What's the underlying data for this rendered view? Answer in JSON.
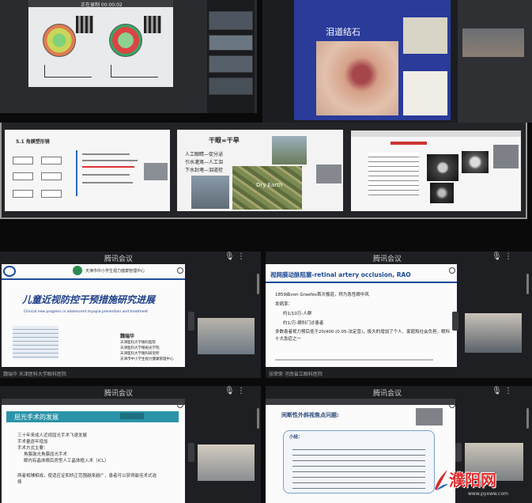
{
  "meeting_app_title": "腾讯会议",
  "tiles": {
    "t1": {
      "toolbar_text": "正在录制 00:00:02"
    },
    "t2": {
      "slide_title": "泪道结石"
    },
    "t3": {
      "heading": "5.1 角膜塑形镜"
    },
    "t4": {
      "title": "干眼=干旱",
      "lines": [
        "人工眼睛—促分泌",
        "引水灌溉—人工泪",
        "下水封堵—泪道栓"
      ],
      "badge": "Dry Earth"
    },
    "t6": {
      "header": "天津市中小学生视力健康管理中心",
      "title": "儿童近视防控干预措施研究进展",
      "subtitle": "Clinical new progress in adolescent myopia prevention and treatment",
      "speaker": "魏瑞华",
      "affiliations": [
        "天津医科大学眼科医院",
        "天津医科大学眼视光学院",
        "天津医科大学眼科研究所",
        "天津市中小学生视力健康管理中心"
      ],
      "footer": "魏瑞华 天津医科大学眼科医院"
    },
    "t7": {
      "title": "视网膜动脉阻塞-retinal artery occlusion, RAO",
      "bullets": [
        "1859由von Graefes首次报道，称为急性眼中风",
        "发病率：",
        "约1/10万-人群",
        "约1/万-眼科门诊患者",
        "多数患者视力预后低于20/400 (0.05-法定盲)，极大的增加了个人、家庭和社会负担，眼科十大急症之一"
      ],
      "footer": "张荣荣 河南省立眼科医院"
    },
    "t8": {
      "title": "屈光手术的发展",
      "lines": [
        "三十年来成人近视屈光手术飞速发展",
        "手术量逐年增加",
        "手术方式主要：",
        "角膜激光角膜屈光手术",
        "眼内有晶体眼后房型人工晶体植入术（ICL）",
        "",
        "两者相辅相成，使适应证和矫正范围越来越广，患者可以获得最佳术式选择"
      ]
    },
    "t9": {
      "title": "间断性外斜视焦点问题:",
      "box_label": "小结："
    }
  },
  "watermark": {
    "text": "濮阳网",
    "url_text": "www.pyxww.com"
  }
}
